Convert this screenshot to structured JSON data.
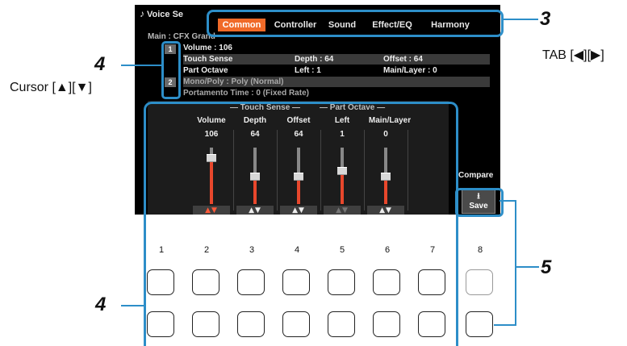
{
  "screen": {
    "title": "Voice Se",
    "tabs": [
      {
        "label": "Common",
        "active": true
      },
      {
        "label": "Controller",
        "active": false
      },
      {
        "label": "Sound",
        "active": false
      },
      {
        "label": "Effect/EQ",
        "active": false
      },
      {
        "label": "Harmony",
        "active": false
      }
    ],
    "main_voice": "Main : CFX Grand",
    "rows": [
      {
        "c1": "Volume : 106",
        "c2": "",
        "c3": ""
      },
      {
        "c1": "Touch Sense",
        "c2": "Depth : 64",
        "c3": "Offset : 64"
      },
      {
        "c1": "Part Octave",
        "c2": "Left : 1",
        "c3": "Main/Layer : 0"
      },
      {
        "c1": "Mono/Poly : Poly (Normal)",
        "c2": "",
        "c3": ""
      },
      {
        "c1": "Portamento Time : 0 (Fixed Rate)",
        "c2": "",
        "c3": ""
      }
    ],
    "page_markers": [
      "1",
      "2"
    ],
    "group_headers": {
      "touch_sense": "Touch Sense",
      "part_octave": "Part Octave"
    },
    "columns": [
      {
        "label": "Volume",
        "value": "106",
        "level": 0.83,
        "arrows": "▲▼",
        "state": "active"
      },
      {
        "label": "Depth",
        "value": "64",
        "level": 0.5,
        "arrows": "▲▼",
        "state": "normal"
      },
      {
        "label": "Offset",
        "value": "64",
        "level": 0.5,
        "arrows": "▲▼",
        "state": "normal"
      },
      {
        "label": "Left",
        "value": "1",
        "level": 0.6,
        "arrows": "▲▼",
        "state": "dim"
      },
      {
        "label": "Main/Layer",
        "value": "0",
        "level": 0.5,
        "arrows": "▲▼",
        "state": "normal"
      }
    ],
    "compare_label": "Compare",
    "save_label": "Save",
    "save_icon": "save-download-icon"
  },
  "panel": {
    "button_numbers": [
      "1",
      "2",
      "3",
      "4",
      "5",
      "6",
      "7",
      "8"
    ]
  },
  "annotations": {
    "cursor_label": "Cursor [▲][▼]",
    "tab_label": "TAB [◀][▶]",
    "num_3": "3",
    "num_4": "4",
    "num_5": "5"
  },
  "colors": {
    "accent": "#f06a28",
    "callout": "#2d8ec8",
    "slider_fill": "#e8472c"
  }
}
